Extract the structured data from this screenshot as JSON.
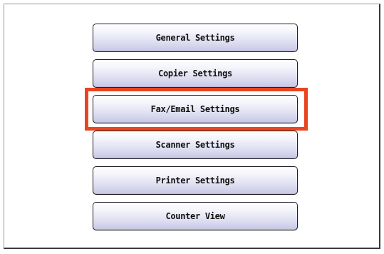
{
  "menu": {
    "items": [
      {
        "label": "General Settings"
      },
      {
        "label": "Copier Settings"
      },
      {
        "label": "Fax/Email Settings"
      },
      {
        "label": "Scanner Settings"
      },
      {
        "label": "Printer Settings"
      },
      {
        "label": "Counter View"
      }
    ],
    "highlighted_item": "Fax/Email Settings"
  },
  "colors": {
    "highlight": "#e84520",
    "button_gradient_top": "#ffffff",
    "button_gradient_bottom": "#c6c6e4",
    "button_border": "#1e1e24"
  }
}
